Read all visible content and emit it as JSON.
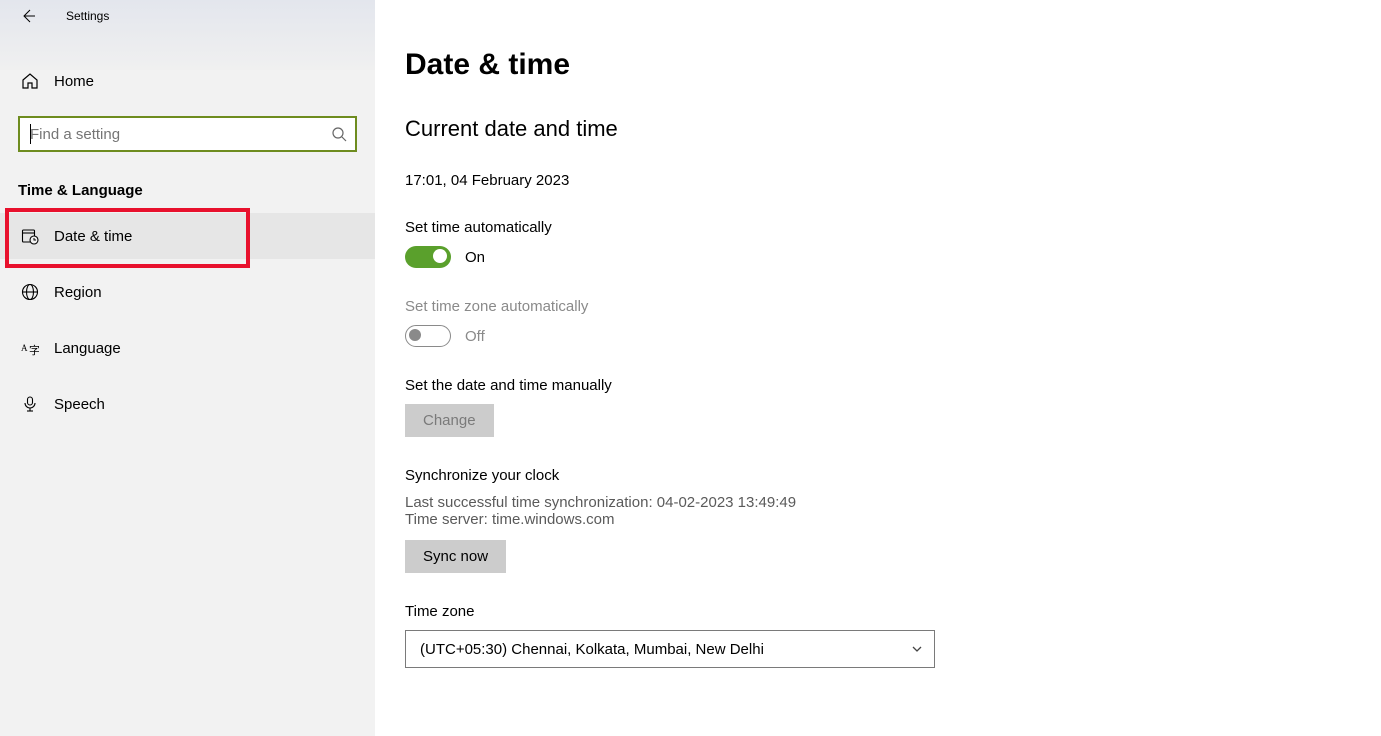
{
  "window": {
    "title": "Settings"
  },
  "sidebar": {
    "home_label": "Home",
    "search_placeholder": "Find a setting",
    "section_label": "Time & Language",
    "items": [
      {
        "label": "Date & time"
      },
      {
        "label": "Region"
      },
      {
        "label": "Language"
      },
      {
        "label": "Speech"
      }
    ]
  },
  "main": {
    "title": "Date & time",
    "current_heading": "Current date and time",
    "current_value": "17:01, 04 February 2023",
    "set_time_auto": {
      "label": "Set time automatically",
      "state": "On"
    },
    "set_tz_auto": {
      "label": "Set time zone automatically",
      "state": "Off"
    },
    "manual": {
      "label": "Set the date and time manually",
      "button": "Change"
    },
    "sync": {
      "heading": "Synchronize your clock",
      "line1": "Last successful time synchronization: 04-02-2023 13:49:49",
      "line2": "Time server: time.windows.com",
      "button": "Sync now"
    },
    "timezone": {
      "label": "Time zone",
      "value": "(UTC+05:30) Chennai, Kolkata, Mumbai, New Delhi"
    }
  }
}
